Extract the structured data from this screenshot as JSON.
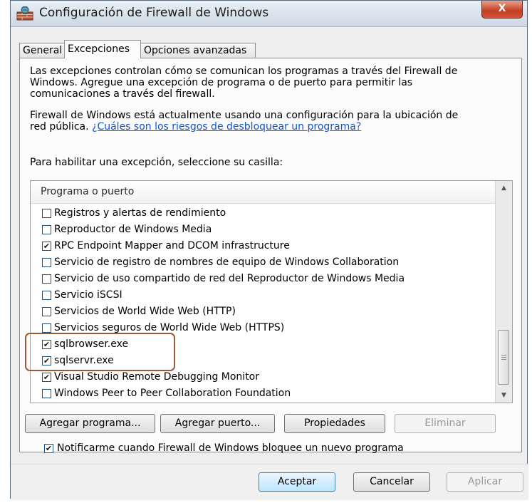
{
  "window": {
    "title": "Configuración de Firewall de Windows",
    "close_label": "X"
  },
  "tabs": [
    {
      "label": "General",
      "active": false
    },
    {
      "label": "Excepciones",
      "active": true
    },
    {
      "label": "Opciones avanzadas",
      "active": false
    }
  ],
  "intro": {
    "line1": "Las excepciones controlan cómo se comunican los programas a través del Firewall de",
    "line2": "Windows. Agregue una excepción de programa o de puerto para permitir las",
    "line3": "comunicaciones a través del firewall."
  },
  "status": {
    "line1": "Firewall de Windows está actualmente usando una configuración para la ubicación de",
    "line2_prefix": "red pública. ",
    "link": "¿Cuáles son los riesgos de desbloquear un programa?"
  },
  "instruction": "Para habilitar una excepción, seleccione su casilla:",
  "list": {
    "header": "Programa o puerto",
    "items": [
      {
        "label": "Registros y alertas de rendimiento",
        "checked": false
      },
      {
        "label": "Reproductor de Windows Media",
        "checked": false
      },
      {
        "label": "RPC Endpoint Mapper and DCOM infrastructure",
        "checked": true
      },
      {
        "label": "Servicio de registro de nombres de equipo de Windows Collaboration",
        "checked": false
      },
      {
        "label": "Servicio de uso compartido de red del Reproductor de Windows Media",
        "checked": false
      },
      {
        "label": "Servicio iSCSI",
        "checked": false
      },
      {
        "label": "Servicios de World Wide Web (HTTP)",
        "checked": false
      },
      {
        "label": "Servicios seguros de World Wide Web (HTTPS)",
        "checked": false
      },
      {
        "label": "sqlbrowser.exe",
        "checked": true
      },
      {
        "label": "sqlservr.exe",
        "checked": true
      },
      {
        "label": "Visual Studio Remote Debugging Monitor",
        "checked": true
      },
      {
        "label": "Windows Peer to Peer Collaboration Foundation",
        "checked": false
      }
    ]
  },
  "buttons": {
    "add_program": "Agregar programa...",
    "add_port": "Agregar puerto...",
    "properties": "Propiedades",
    "delete": "Eliminar"
  },
  "notify": {
    "label": "Notificarme cuando Firewall de Windows bloquee un nuevo programa",
    "checked": true
  },
  "footer": {
    "ok": "Aceptar",
    "cancel": "Cancelar",
    "apply": "Aplicar"
  },
  "colors": {
    "link": "#1155cc",
    "highlight": "#9a5a3a",
    "close": "#c23d22"
  }
}
